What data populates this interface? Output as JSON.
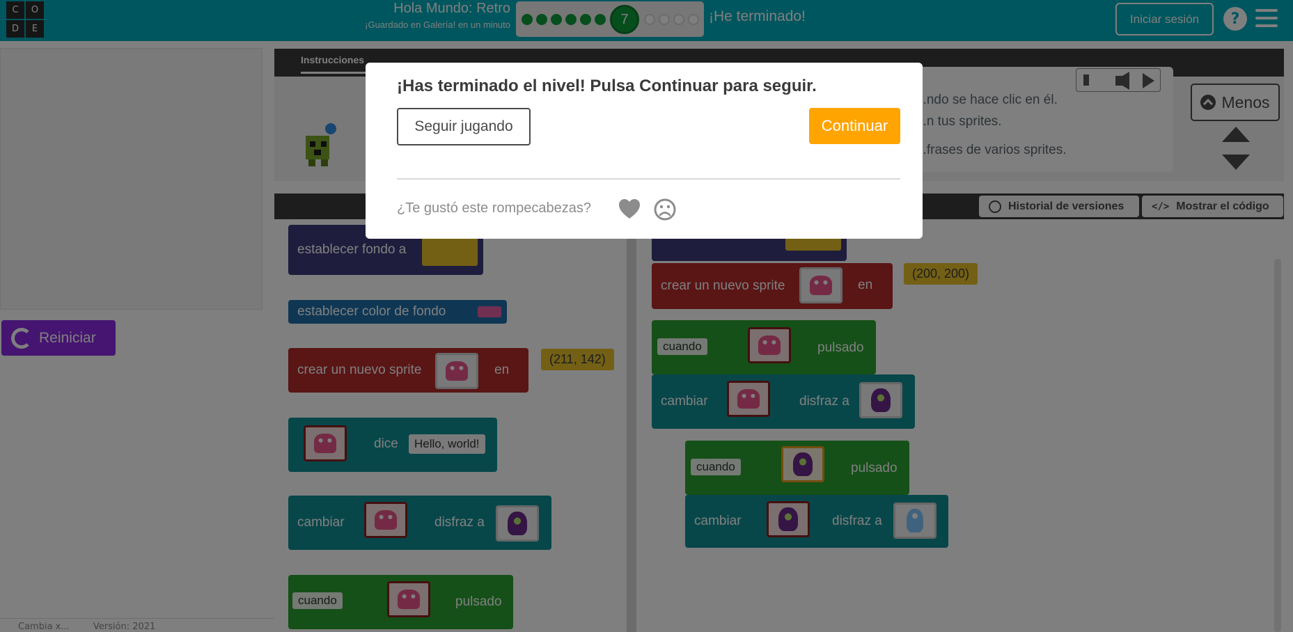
{
  "header": {
    "logo_letters": [
      "C",
      "O",
      "D",
      "E"
    ],
    "project_title": "Hola Mundo: Retro",
    "save_status": "¡Guardado en Galería! en un minuto",
    "current_level": "7",
    "completed_levels": 6,
    "remaining_levels": 4,
    "finish_label": "¡He terminado!",
    "signin_label": "Iniciar sesión",
    "help_label": "?"
  },
  "stage": {
    "reset_label": "Reiniciar"
  },
  "footer": {
    "left_text": "Cambia x...",
    "version_text": "Versión: 2021"
  },
  "instructions": {
    "tab_label": "Instrucciones",
    "line1": "...ndo se hace clic en él.",
    "line2": "...n tus sprites.",
    "line3": "...frases de varios sprites.",
    "less_label": "Menos",
    "hint_count": "1"
  },
  "workspace_bar": {
    "history_label": "Historial de versiones",
    "show_code_label": "Mostrar el código"
  },
  "toolbox": {
    "set_background": "establecer fondo a",
    "set_background_color": "establecer color de fondo",
    "create_sprite": "crear un nuevo sprite",
    "at": "en",
    "coord1": "(211, 142)",
    "says": "dice",
    "hello": "Hello, world!",
    "change": "cambiar",
    "costume_to": "disfraz a",
    "when": "cuando",
    "clicked": "pulsado"
  },
  "workspace": {
    "set_background_partial": "establecer fondo a",
    "create_sprite": "crear un nuevo sprite",
    "at": "en",
    "coord2": "(200, 200)",
    "when": "cuando",
    "clicked": "pulsado",
    "change": "cambiar",
    "costume_to": "disfraz a"
  },
  "modal": {
    "title": "¡Has terminado el nivel! Pulsa Continuar para seguir.",
    "keep_playing": "Seguir jugando",
    "continue": "Continuar",
    "feedback_question": "¿Te gustó este rompecabezas?"
  },
  "colors": {
    "header": "#00adbc",
    "continue": "#ffa400",
    "level_done": "#0f9d3a",
    "reset": "#8a2be2"
  }
}
